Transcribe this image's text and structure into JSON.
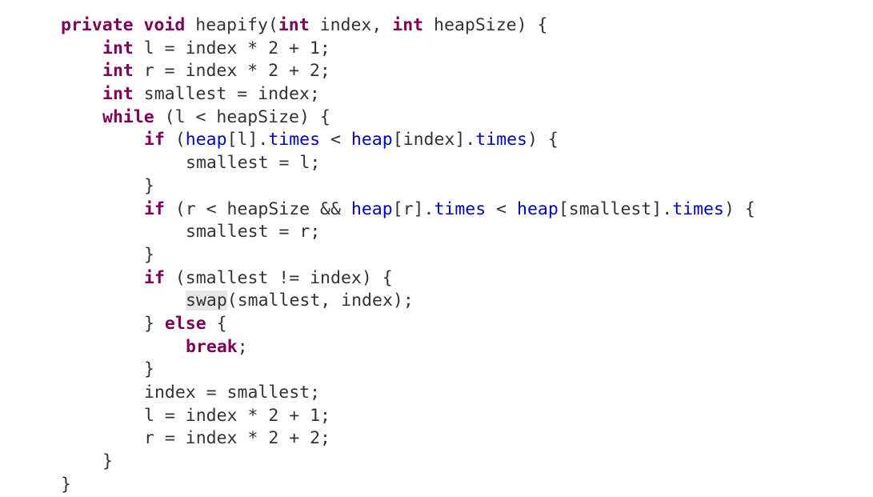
{
  "editor": {
    "colors": {
      "keyword": "#7f0055",
      "field": "#0000c0",
      "text": "#333333",
      "highlight": "#e6e6e6",
      "background": "#ffffff"
    },
    "lines": [
      [
        {
          "t": "private void",
          "c": "kw"
        },
        {
          "t": " heapify("
        },
        {
          "t": "int",
          "c": "kw"
        },
        {
          "t": " index, "
        },
        {
          "t": "int",
          "c": "kw"
        },
        {
          "t": " heapSize) {"
        }
      ],
      [
        {
          "t": "int",
          "c": "kw"
        },
        {
          "t": " l = index * 2 + 1;"
        }
      ],
      [
        {
          "t": "int",
          "c": "kw"
        },
        {
          "t": " r = index * 2 + 2;"
        }
      ],
      [
        {
          "t": "int",
          "c": "kw"
        },
        {
          "t": " smallest = index;"
        }
      ],
      [
        {
          "t": "while",
          "c": "kw"
        },
        {
          "t": " (l < heapSize) {"
        }
      ],
      [
        {
          "t": "if",
          "c": "kw"
        },
        {
          "t": " ("
        },
        {
          "t": "heap",
          "c": "fld"
        },
        {
          "t": "[l]."
        },
        {
          "t": "times",
          "c": "fld"
        },
        {
          "t": " < "
        },
        {
          "t": "heap",
          "c": "fld"
        },
        {
          "t": "[index]."
        },
        {
          "t": "times",
          "c": "fld"
        },
        {
          "t": ") {"
        }
      ],
      [
        {
          "t": "smallest = l;"
        }
      ],
      [
        {
          "t": "}"
        }
      ],
      [
        {
          "t": "if",
          "c": "kw"
        },
        {
          "t": " (r < heapSize && "
        },
        {
          "t": "heap",
          "c": "fld"
        },
        {
          "t": "[r]."
        },
        {
          "t": "times",
          "c": "fld"
        },
        {
          "t": " < "
        },
        {
          "t": "heap",
          "c": "fld"
        },
        {
          "t": "[smallest]."
        },
        {
          "t": "times",
          "c": "fld"
        },
        {
          "t": ") {"
        }
      ],
      [
        {
          "t": "smallest = r;"
        }
      ],
      [
        {
          "t": "}"
        }
      ],
      [
        {
          "t": "if",
          "c": "kw"
        },
        {
          "t": " (smallest != index) {"
        }
      ],
      [
        {
          "t": "swap",
          "c": "hl"
        },
        {
          "t": "(smallest, index);"
        }
      ],
      [
        {
          "t": "} "
        },
        {
          "t": "else",
          "c": "kw"
        },
        {
          "t": " {"
        }
      ],
      [
        {
          "t": "break",
          "c": "kw"
        },
        {
          "t": ";"
        }
      ],
      [
        {
          "t": "}"
        }
      ],
      [
        {
          "t": "index = smallest;"
        }
      ],
      [
        {
          "t": "l = index * 2 + 1;"
        }
      ],
      [
        {
          "t": "r = index * 2 + 2;"
        }
      ],
      [
        {
          "t": "}"
        }
      ],
      [
        {
          "t": "}"
        }
      ]
    ]
  }
}
